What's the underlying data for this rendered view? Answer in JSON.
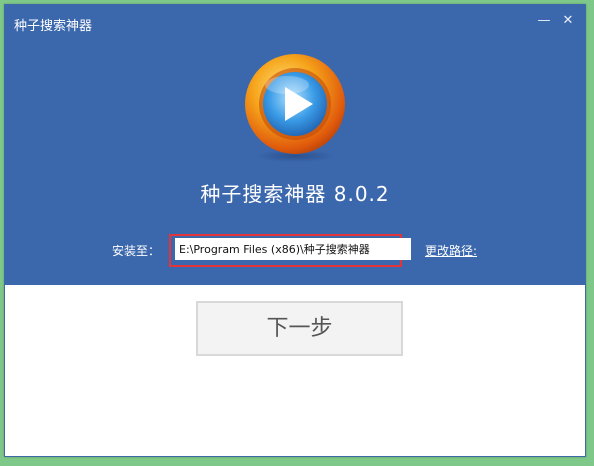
{
  "window": {
    "title": "种子搜索神器",
    "minimize_glyph": "—",
    "close_glyph": "✕"
  },
  "app": {
    "name": "种子搜索神器 8.0.2",
    "logo_icon": "play-logo-icon"
  },
  "install": {
    "label": "安装至：",
    "path_value": "E:\\Program Files (x86)\\种子搜索神器",
    "change_path_label": "更改路径:"
  },
  "actions": {
    "next_label": "下一步"
  },
  "colors": {
    "header_bg": "#3b67ad",
    "highlight_border": "#e2343b",
    "logo_orange": "#f18a15",
    "play_blue": "#2f8bd8"
  }
}
